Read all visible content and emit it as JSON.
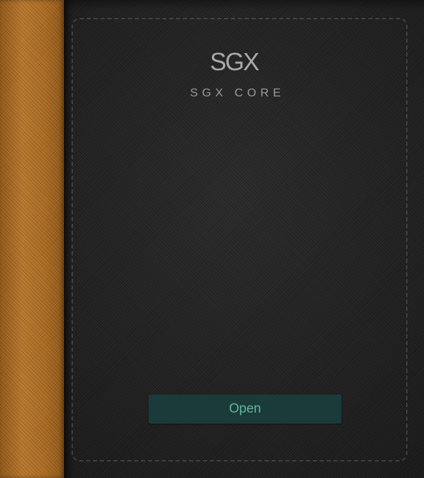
{
  "cover": {
    "logo_text": "SGX",
    "subtitle": "SGX CORE",
    "open_label": "Open"
  },
  "colors": {
    "spine": "#a56a25",
    "cover_background": "#222222",
    "button_background": "#1b3b3a",
    "button_text": "#62b79d",
    "logo_text": "#a9a9a9"
  }
}
